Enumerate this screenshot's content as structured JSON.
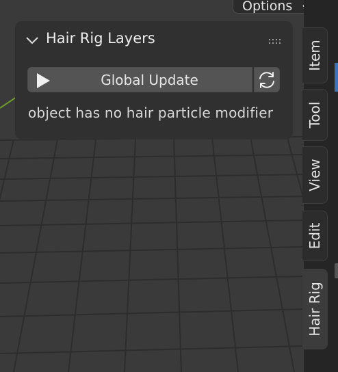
{
  "toolbar": {
    "options_label": "Options"
  },
  "panel": {
    "title": "Hair Rig Layers",
    "global_update_label": "Global Update",
    "status_message": "object has no hair particle modifier"
  },
  "sidebar": {
    "tabs": [
      {
        "label": "Item",
        "active": false
      },
      {
        "label": "Tool",
        "active": false
      },
      {
        "label": "View",
        "active": false
      },
      {
        "label": "Edit",
        "active": false
      },
      {
        "label": "Hair Rig",
        "active": true
      }
    ]
  },
  "colors": {
    "viewport_bg": "#3a3a3a",
    "grid_line": "#2e2e2e",
    "panel_bg": "#303030",
    "button_bg": "#545454",
    "accent": "#3c74b8",
    "axis_green": "#6f9a2c"
  },
  "icons": [
    "chevron-down-icon",
    "drag-grip-icon",
    "play-icon",
    "refresh-icon"
  ]
}
